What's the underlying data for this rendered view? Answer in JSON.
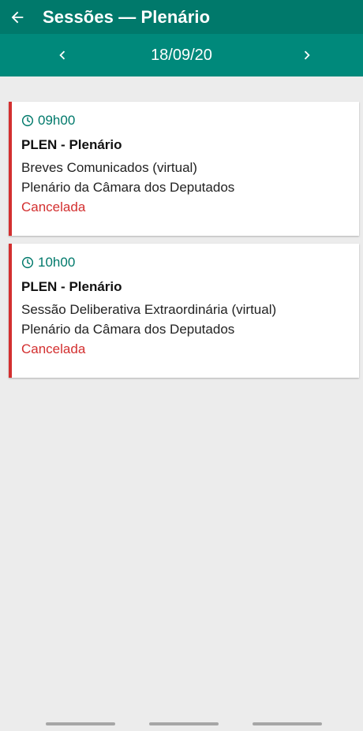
{
  "app_bar": {
    "title": "Sessões — Plenário",
    "back_icon": "arrow-left-icon",
    "background": "#00796b"
  },
  "date_nav": {
    "date": "18/09/20",
    "prev_icon": "chevron-left-icon",
    "next_icon": "chevron-right-icon",
    "background": "#00897b"
  },
  "sessions": [
    {
      "time": "09h00",
      "organ": "PLEN - Plenário",
      "description": "Breves Comunicados (virtual)",
      "location": "Plenário da Câmara dos Deputados",
      "status": "Cancelada"
    },
    {
      "time": "10h00",
      "organ": "PLEN - Plenário",
      "description": "Sessão Deliberativa Extraordinária (virtual)",
      "location": "Plenário da Câmara dos Deputados",
      "status": "Cancelada"
    }
  ],
  "colors": {
    "accent": "#00796b",
    "cancelled": "#d32f2f",
    "background": "#ececec"
  }
}
